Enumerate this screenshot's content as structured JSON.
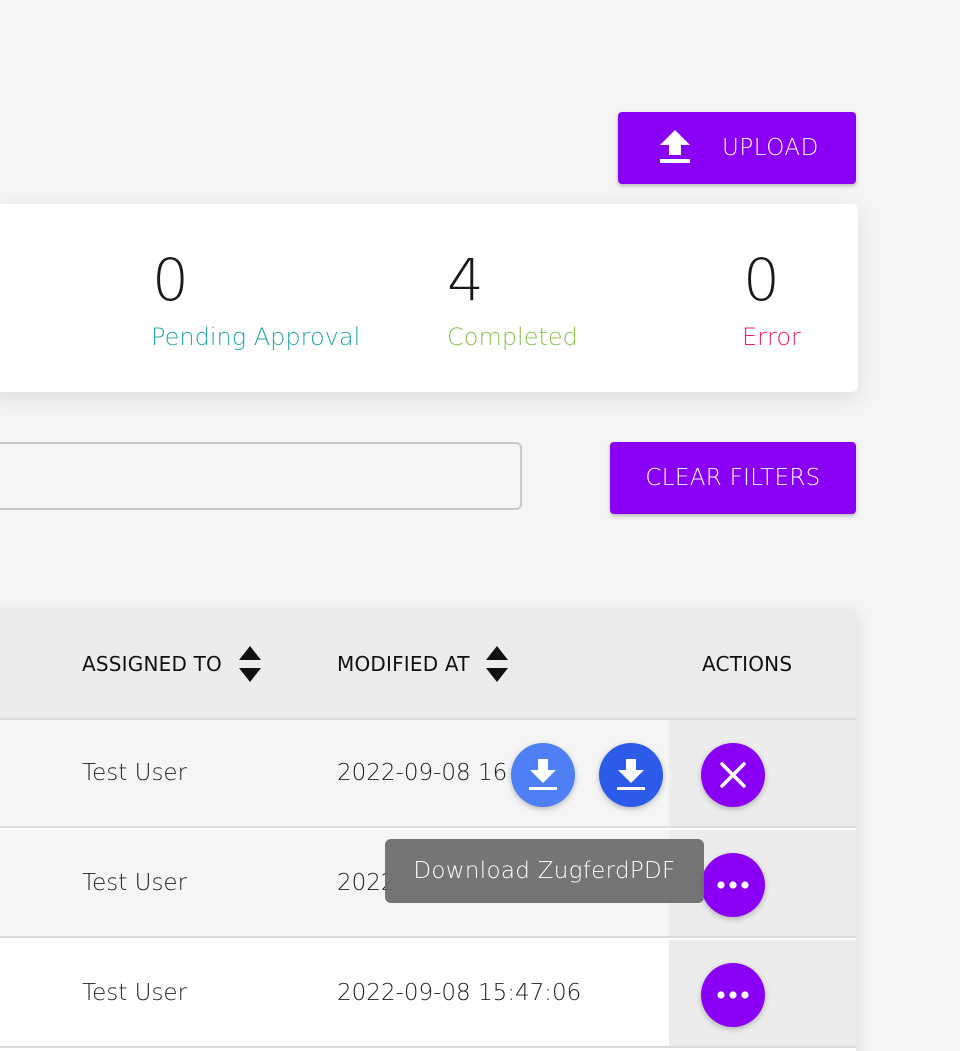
{
  "toolbar": {
    "upload_label": "UPLOAD"
  },
  "stats": {
    "pending": {
      "value": "0",
      "label": "Pending Approval"
    },
    "completed": {
      "value": "4",
      "label": "Completed"
    },
    "error": {
      "value": "0",
      "label": "Error"
    }
  },
  "filters": {
    "search_value": "",
    "clear_label": "CLEAR FILTERS"
  },
  "table": {
    "columns": {
      "assigned_to": "ASSIGNED TO",
      "modified_at": "MODIFIED AT",
      "actions": "ACTIONS"
    },
    "rows": [
      {
        "assigned_to": "Test User",
        "modified_at": "2022-09-08 16"
      },
      {
        "assigned_to": "Test User",
        "modified_at": "2022"
      },
      {
        "assigned_to": "Test User",
        "modified_at": "2022-09-08 15:47:06"
      }
    ]
  },
  "tooltip": {
    "text": "Download ZugferdPDF"
  },
  "icons": {
    "upload": "upload-icon",
    "download": "download-icon",
    "close": "close-icon",
    "more": "more-horizontal-icon",
    "sort": "sort-icon"
  },
  "colors": {
    "accent": "#8a00f5",
    "pending": "#2aa3a8",
    "completed": "#8cc152",
    "error": "#e8245a",
    "download_light": "#4f7ff5",
    "download": "#2b5be8"
  }
}
